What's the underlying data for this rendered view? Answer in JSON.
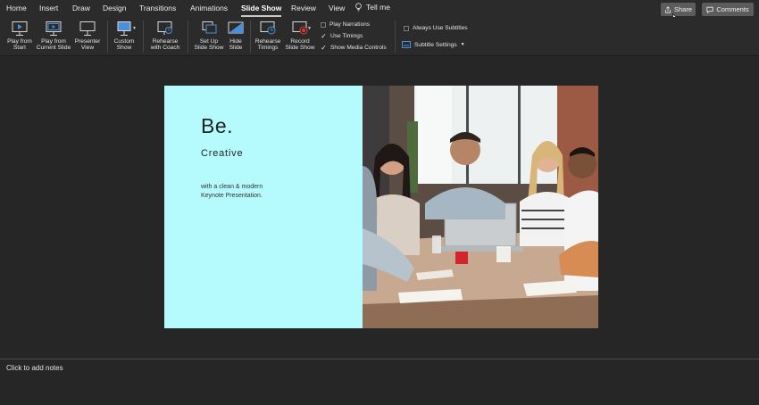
{
  "menu": {
    "tabs": [
      {
        "label": "Home"
      },
      {
        "label": "Insert"
      },
      {
        "label": "Draw"
      },
      {
        "label": "Design"
      },
      {
        "label": "Transitions"
      },
      {
        "label": "Animations"
      },
      {
        "label": "Slide Show",
        "active": true
      },
      {
        "label": "Review"
      },
      {
        "label": "View"
      }
    ],
    "tell_me": "Tell me",
    "share": "Share",
    "comments": "Comments"
  },
  "ribbon": {
    "play_from_start": [
      "Play from",
      "Start"
    ],
    "play_from_current": [
      "Play from",
      "Current Slide"
    ],
    "presenter_view": [
      "Presenter",
      "View"
    ],
    "custom_show": [
      "Custom",
      "Show"
    ],
    "rehearse_with_coach": [
      "Rehearse",
      "with Coach"
    ],
    "set_up_slide_show": [
      "Set Up",
      "Slide Show"
    ],
    "hide_slide": [
      "Hide",
      "Slide"
    ],
    "rehearse_timings": [
      "Rehearse",
      "Timings"
    ],
    "record_slide_show": [
      "Record",
      "Slide Show"
    ],
    "checkboxes": [
      {
        "label": "Play Narrations",
        "checked": false
      },
      {
        "label": "Use Timings",
        "checked": true
      },
      {
        "label": "Show Media Controls",
        "checked": true
      }
    ],
    "always_use_subtitles": {
      "label": "Always Use Subtitles",
      "checked": false
    },
    "subtitle_settings": "Subtitle Settings",
    "accent_color": "#4a8fd8",
    "record_color": "#e03a3a"
  },
  "slide": {
    "title": "Be.",
    "subtitle": "Creative",
    "body_line1": "with a clean & modern",
    "body_line2": "Keynote Presentation.",
    "background_color": "#b5fbfd"
  },
  "notes": {
    "placeholder": "Click to add notes"
  }
}
